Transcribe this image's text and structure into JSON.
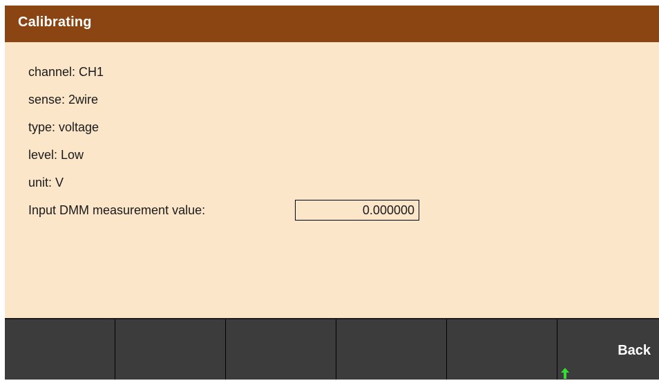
{
  "dialog": {
    "title": "Calibrating"
  },
  "info": {
    "channel": "channel: CH1",
    "sense": "sense: 2wire",
    "type": "type: voltage",
    "level": "level: Low",
    "unit": "unit: V",
    "input_label": "Input DMM measurement value:",
    "input_value": "0.000000"
  },
  "softkeys": {
    "key1": "",
    "key2": "",
    "key3": "",
    "key4": "",
    "key5": "",
    "key6": "Back"
  },
  "icons": {
    "back_indicator": "arrow-up-icon"
  },
  "colors": {
    "title_bar": "#8b4513",
    "content_bg": "#fbe6c9",
    "softkey_bg": "#3c3c3c",
    "arrow": "#33dd33"
  }
}
